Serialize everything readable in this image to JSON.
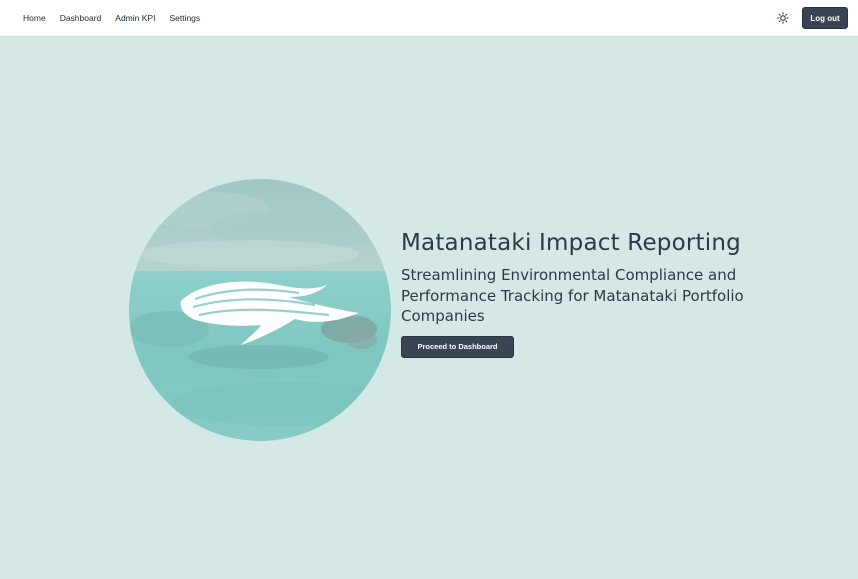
{
  "nav": {
    "links": [
      {
        "label": "Home"
      },
      {
        "label": "Dashboard"
      },
      {
        "label": "Admin KPI"
      },
      {
        "label": "Settings"
      }
    ],
    "theme_toggle_icon": "sun-icon",
    "logout_label": "Log out"
  },
  "hero": {
    "image_description_icon": "fish-logo-icon",
    "title": "Matanataki Impact Reporting",
    "subtitle": "Streamlining Environmental Compliance and Performance Tracking for Matanataki Portfolio Companies",
    "cta_label": "Proceed to Dashboard"
  },
  "colors": {
    "page_background": "#d4e8e6",
    "navbar_background": "#ffffff",
    "button_background": "#3a4553",
    "text": "#2d3a45"
  }
}
